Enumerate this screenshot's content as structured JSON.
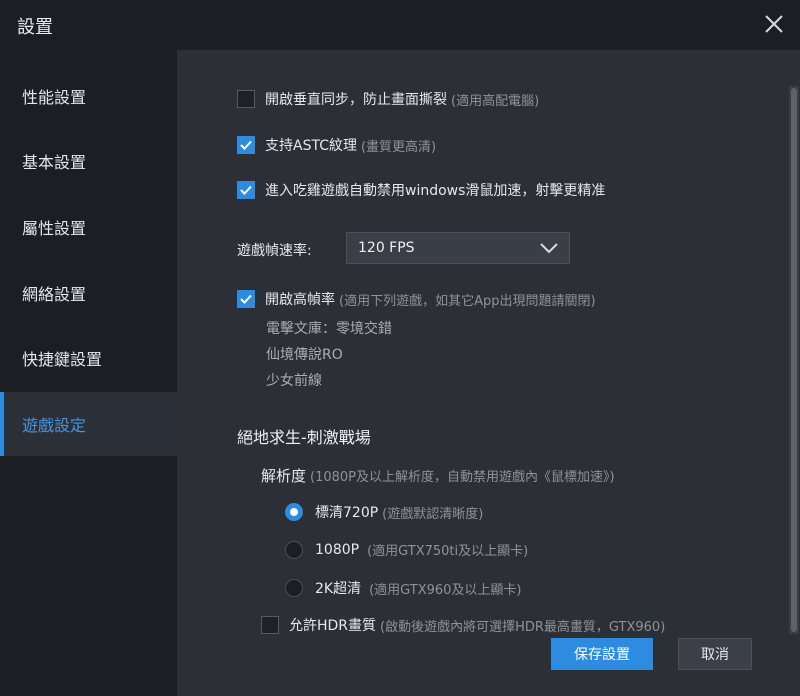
{
  "window": {
    "title": "設置"
  },
  "sidebar": {
    "items": [
      {
        "label": "性能設置",
        "active": false
      },
      {
        "label": "基本設置",
        "active": false
      },
      {
        "label": "屬性設置",
        "active": false
      },
      {
        "label": "網絡設置",
        "active": false
      },
      {
        "label": "快捷鍵設置",
        "active": false
      },
      {
        "label": "遊戲設定",
        "active": true
      }
    ]
  },
  "settings": {
    "vsync": {
      "label": "開啟垂直同步，防止畫面撕裂",
      "hint": "(適用高配電腦)",
      "checked": false
    },
    "astc": {
      "label": "支持ASTC紋理",
      "hint": "(畫質更高清)",
      "checked": true
    },
    "pubg_mouse": {
      "label": "進入吃雞遊戲自動禁用windows滑鼠加速，射擊更精准",
      "checked": true
    },
    "framerate": {
      "label": "遊戲幀速率:",
      "value": "120 FPS"
    },
    "high_fps": {
      "label": "開啟高幀率",
      "hint": "(適用下列遊戲，如其它App出現問題請關閉)",
      "checked": true,
      "games": [
        "電擊文庫：零境交錯",
        "仙境傳說RO",
        "少女前線"
      ]
    }
  },
  "pubg_section": {
    "title": "絕地求生-刺激戰場",
    "resolution_label": "解析度",
    "resolution_hint": "(1080P及以上解析度，自動禁用遊戲內《鼠標加速》)",
    "options": [
      {
        "label": "標清720P",
        "hint": "(遊戲默認清晰度)",
        "selected": true
      },
      {
        "label": "1080P",
        "hint": "(適用GTX750ti及以上顯卡)",
        "selected": false
      },
      {
        "label": "2K超清",
        "hint": "(適用GTX960及以上顯卡)",
        "selected": false
      }
    ],
    "hdr": {
      "label": "允許HDR畫質",
      "hint": "(啟動後遊戲內將可選擇HDR最高畫質，GTX960)",
      "checked": false
    }
  },
  "buttons": {
    "save": "保存設置",
    "cancel": "取消"
  },
  "colors": {
    "accent": "#2d8ce0",
    "sidebar_bg": "#1b1e23",
    "content_bg": "#2c2f36"
  }
}
